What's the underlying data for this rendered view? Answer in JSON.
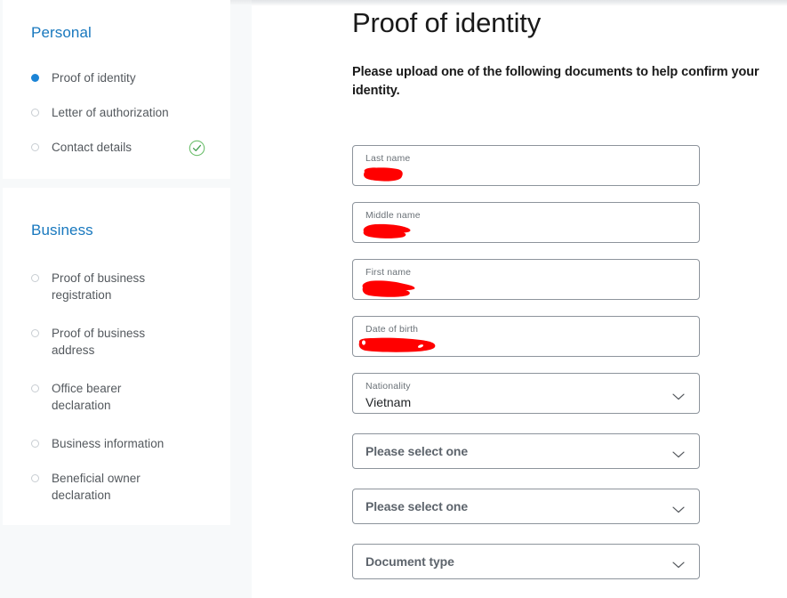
{
  "sidebar": {
    "sections": [
      {
        "heading": "Personal",
        "items": [
          {
            "label": "Proof of identity",
            "state": "active",
            "completed": false
          },
          {
            "label": "Letter of authorization",
            "state": "inactive",
            "completed": false
          },
          {
            "label": "Contact details",
            "state": "inactive",
            "completed": true
          }
        ]
      },
      {
        "heading": "Business",
        "items": [
          {
            "label": "Proof of business registration",
            "state": "inactive",
            "completed": false
          },
          {
            "label": "Proof of business address",
            "state": "inactive",
            "completed": false
          },
          {
            "label": "Office bearer declaration",
            "state": "inactive",
            "completed": false
          },
          {
            "label": "Business information",
            "state": "inactive",
            "completed": false
          },
          {
            "label": "Beneficial owner declaration",
            "state": "inactive",
            "completed": false
          }
        ]
      }
    ]
  },
  "main": {
    "title": "Proof of identity",
    "subtitle": "Please upload one of the following documents to help confirm your identity.",
    "fields": [
      {
        "kind": "text",
        "label": "Last name",
        "value": "",
        "redacted": true
      },
      {
        "kind": "text",
        "label": "Middle name",
        "value": "",
        "redacted": true
      },
      {
        "kind": "text",
        "label": "First name",
        "value": "",
        "redacted": true
      },
      {
        "kind": "text",
        "label": "Date of birth",
        "value": "",
        "redacted": true
      },
      {
        "kind": "select-filled",
        "label": "Nationality",
        "value": "Vietnam"
      },
      {
        "kind": "select",
        "placeholder": "Please select one"
      },
      {
        "kind": "select",
        "placeholder": "Please select one"
      },
      {
        "kind": "select",
        "placeholder": "Document type"
      }
    ]
  },
  "icons": {
    "completed": "check-circle-icon",
    "dropdown": "chevron-down-icon"
  },
  "colors": {
    "accent_blue": "#1878be",
    "active_bullet": "#1b84d6",
    "success_green": "#5cb85c",
    "redaction_red": "#ff0000",
    "page_background": "#f7f9fa",
    "field_border": "#8d949c"
  }
}
